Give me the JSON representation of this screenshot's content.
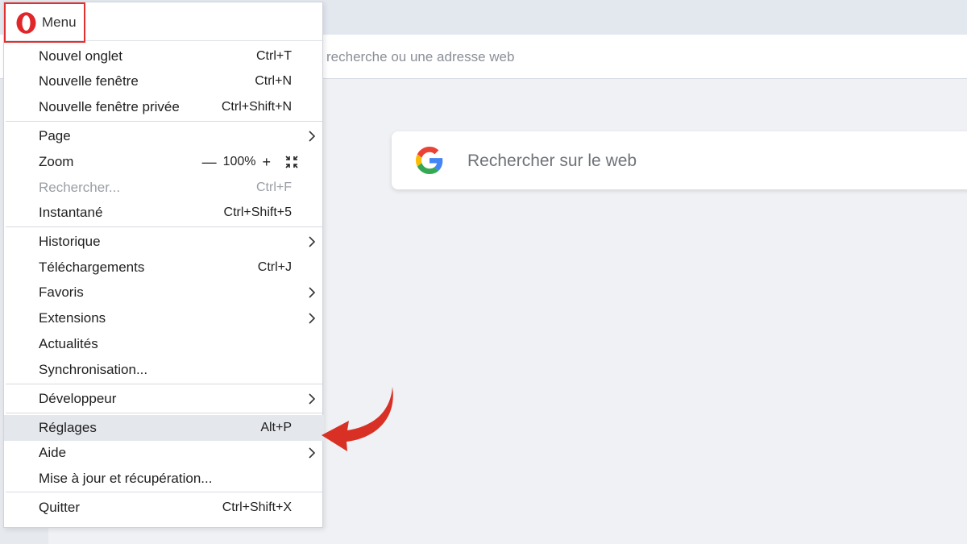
{
  "browser": {
    "address_placeholder": "recherche ou une adresse web",
    "search_placeholder": "Rechercher sur le web"
  },
  "menu": {
    "button_label": "Menu",
    "items": [
      {
        "label": "Nouvel onglet",
        "shortcut": "Ctrl+T"
      },
      {
        "label": "Nouvelle fenêtre",
        "shortcut": "Ctrl+N"
      },
      {
        "label": "Nouvelle fenêtre privée",
        "shortcut": "Ctrl+Shift+N"
      },
      {
        "label": "Page",
        "shortcut": ""
      },
      {
        "label": "Zoom",
        "shortcut": ""
      },
      {
        "label": "Rechercher...",
        "shortcut": "Ctrl+F"
      },
      {
        "label": "Instantané",
        "shortcut": "Ctrl+Shift+5"
      },
      {
        "label": "Historique",
        "shortcut": ""
      },
      {
        "label": "Téléchargements",
        "shortcut": "Ctrl+J"
      },
      {
        "label": "Favoris",
        "shortcut": ""
      },
      {
        "label": "Extensions",
        "shortcut": ""
      },
      {
        "label": "Actualités",
        "shortcut": ""
      },
      {
        "label": "Synchronisation...",
        "shortcut": ""
      },
      {
        "label": "Développeur",
        "shortcut": ""
      },
      {
        "label": "Réglages",
        "shortcut": "Alt+P"
      },
      {
        "label": "Aide",
        "shortcut": ""
      },
      {
        "label": "Mise à jour et récupération...",
        "shortcut": ""
      },
      {
        "label": "Quitter",
        "shortcut": "Ctrl+Shift+X"
      }
    ],
    "zoom": {
      "minus": "—",
      "level": "100%",
      "plus": "+"
    }
  },
  "colors": {
    "accent_red": "#e03130",
    "highlight": "#e4e7ec"
  }
}
